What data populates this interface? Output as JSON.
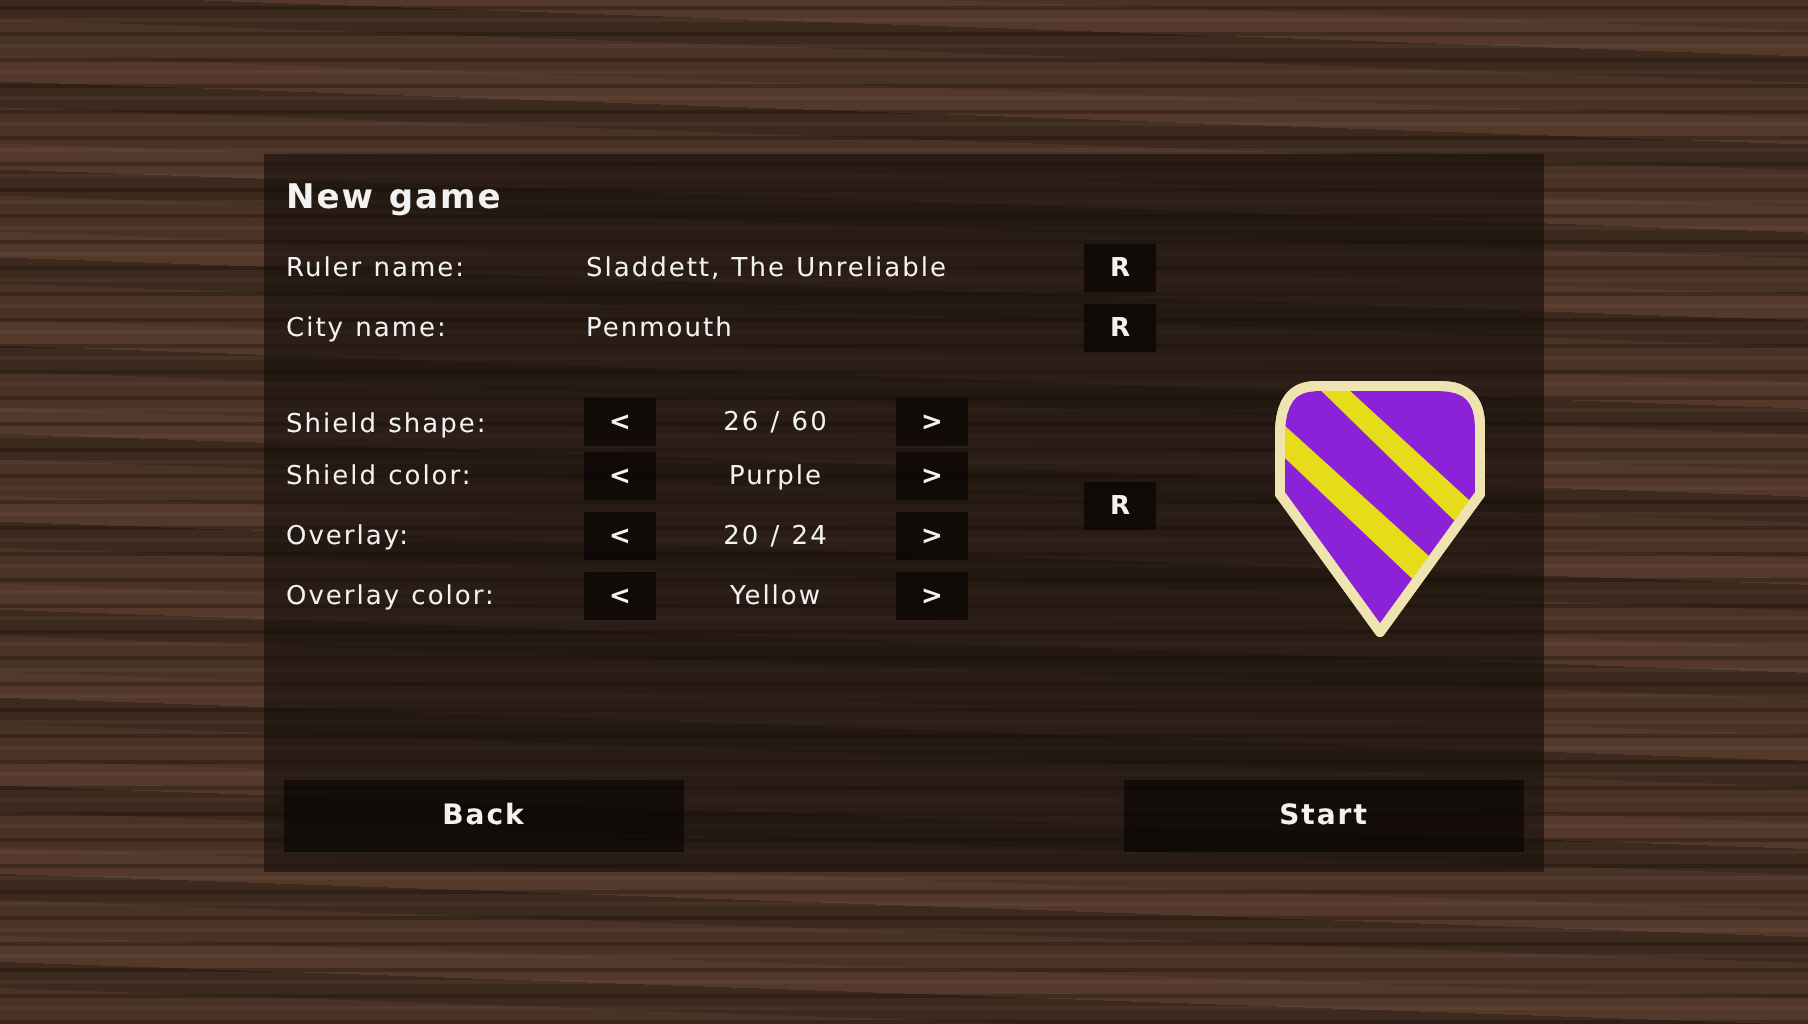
{
  "title": "New game",
  "name_fields": [
    {
      "label": "Ruler name:",
      "value": "Sladdett, The Unreliable",
      "button": "R"
    },
    {
      "label": "City name:",
      "value": "Penmouth",
      "button": "R"
    }
  ],
  "selectors": [
    {
      "label": "Shield shape:",
      "prev": "<",
      "value": "26 / 60",
      "next": ">"
    },
    {
      "label": "Shield color:",
      "prev": "<",
      "value": "Purple",
      "next": ">"
    },
    {
      "label": "Overlay:",
      "prev": "<",
      "value": "20 / 24",
      "next": ">"
    },
    {
      "label": "Overlay color:",
      "prev": "<",
      "value": "Yellow",
      "next": ">"
    }
  ],
  "shield_random_button": "R",
  "buttons": [
    "Back",
    "Start"
  ]
}
